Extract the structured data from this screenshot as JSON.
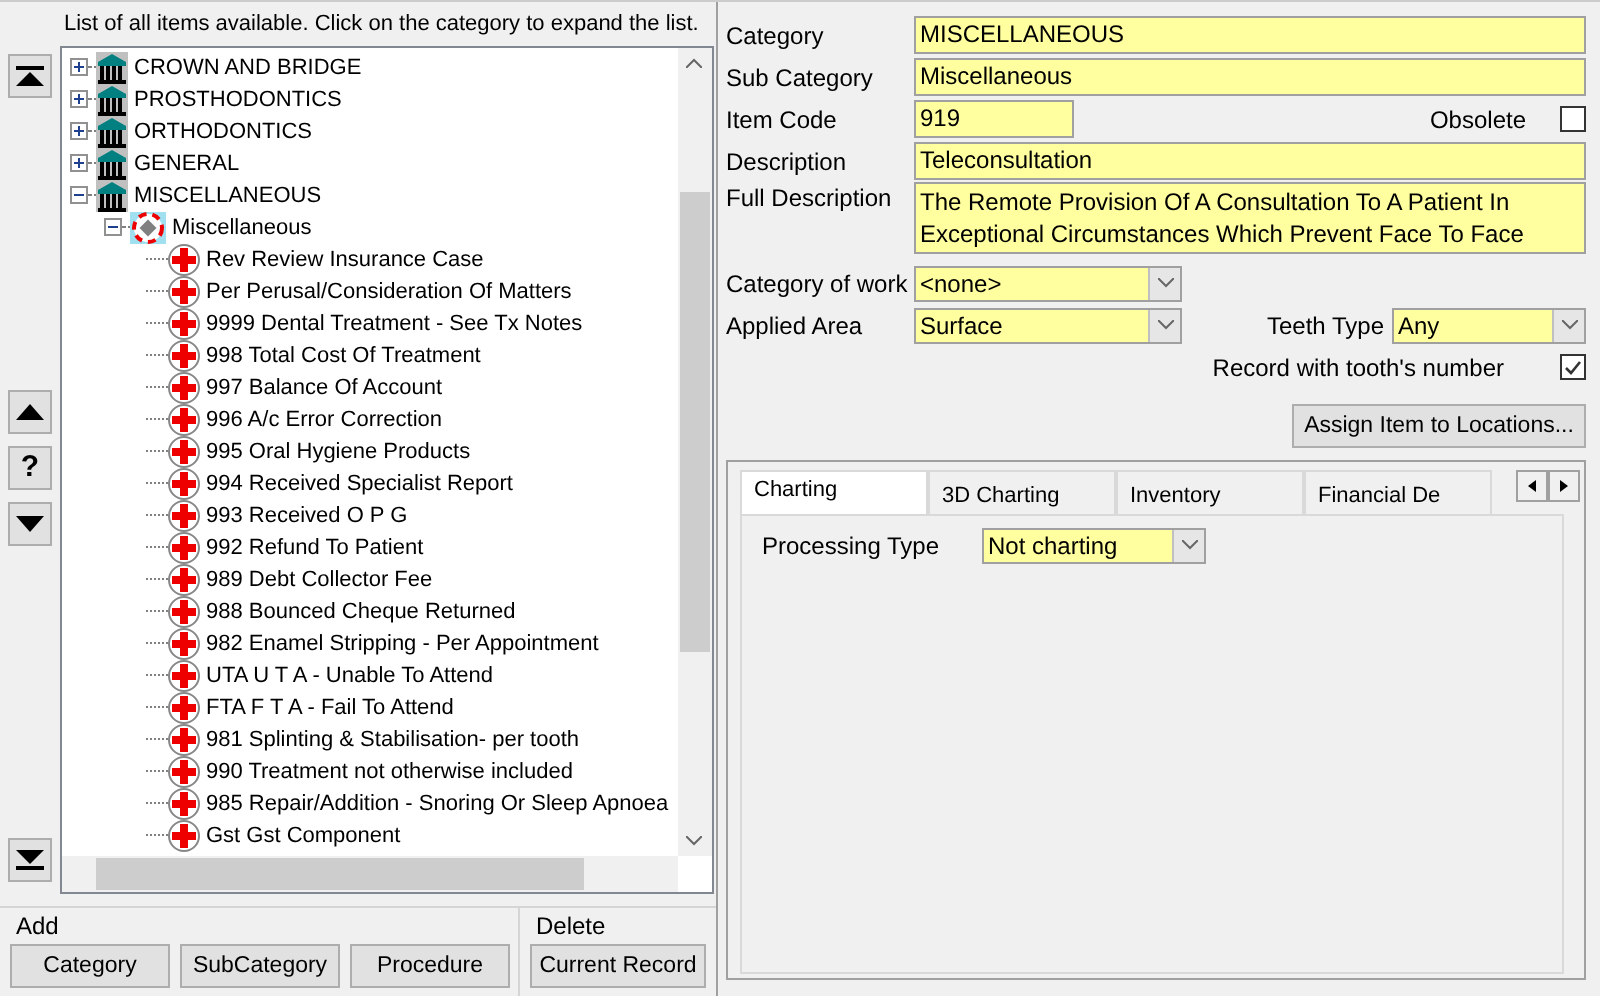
{
  "header": "List of all items available. Click on the category to expand the list.",
  "nav": {
    "help": "?"
  },
  "tree": [
    {
      "kind": "category",
      "label": "CROWN AND BRIDGE",
      "expanded": false
    },
    {
      "kind": "category",
      "label": "PROSTHODONTICS",
      "expanded": false
    },
    {
      "kind": "category",
      "label": "ORTHODONTICS",
      "expanded": false
    },
    {
      "kind": "category",
      "label": "GENERAL",
      "expanded": false
    },
    {
      "kind": "category",
      "label": "MISCELLANEOUS",
      "expanded": true,
      "children": [
        {
          "kind": "subcategory",
          "label": "Miscellaneous",
          "expanded": true,
          "children": [
            {
              "kind": "procedure",
              "label": "Rev Review Insurance Case"
            },
            {
              "kind": "procedure",
              "label": "Per Perusal/Consideration Of Matters"
            },
            {
              "kind": "procedure",
              "label": "9999 Dental Treatment - See Tx Notes"
            },
            {
              "kind": "procedure",
              "label": "998 Total Cost Of Treatment"
            },
            {
              "kind": "procedure",
              "label": "997 Balance Of Account"
            },
            {
              "kind": "procedure",
              "label": "996 A/c Error Correction"
            },
            {
              "kind": "procedure",
              "label": "995 Oral Hygiene Products"
            },
            {
              "kind": "procedure",
              "label": "994 Received Specialist Report"
            },
            {
              "kind": "procedure",
              "label": "993 Received O P G"
            },
            {
              "kind": "procedure",
              "label": "992 Refund To Patient"
            },
            {
              "kind": "procedure",
              "label": "989 Debt Collector Fee"
            },
            {
              "kind": "procedure",
              "label": "988 Bounced Cheque Returned"
            },
            {
              "kind": "procedure",
              "label": "982 Enamel Stripping - Per Appointment"
            },
            {
              "kind": "procedure",
              "label": "UTA U T A - Unable To Attend"
            },
            {
              "kind": "procedure",
              "label": "FTA F T A - Fail To Attend"
            },
            {
              "kind": "procedure",
              "label": "981 Splinting & Stabilisation- per tooth"
            },
            {
              "kind": "procedure",
              "label": "990 Treatment not otherwise included"
            },
            {
              "kind": "procedure",
              "label": "985 Repair/Addition - Snoring Or Sleep Apnoea"
            },
            {
              "kind": "procedure",
              "label": "Gst Gst Component"
            }
          ]
        }
      ]
    }
  ],
  "add": {
    "label": "Add",
    "buttons": [
      "Category",
      "SubCategory",
      "Procedure"
    ]
  },
  "delete": {
    "label": "Delete",
    "button": "Current Record"
  },
  "form": {
    "category": {
      "label": "Category",
      "value": "MISCELLANEOUS"
    },
    "sub_category": {
      "label": "Sub Category",
      "value": "Miscellaneous"
    },
    "item_code": {
      "label": "Item Code",
      "value": "919"
    },
    "obsolete": {
      "label": "Obsolete",
      "checked": false
    },
    "description": {
      "label": "Description",
      "value": "Teleconsultation"
    },
    "full_description": {
      "label": "Full Description",
      "value": "The Remote Provision Of A Consultation To A Patient In Exceptional Circumstances Which Prevent Face To Face"
    },
    "category_of_work": {
      "label": "Category of work",
      "value": "<none>"
    },
    "applied_area": {
      "label": "Applied Area",
      "value": "Surface"
    },
    "teeth_type": {
      "label": "Teeth Type",
      "value": "Any"
    },
    "record_with_tooth": {
      "label": "Record with tooth's number",
      "checked": true
    },
    "assign_button": "Assign Item to Locations..."
  },
  "tabs": [
    {
      "label": "Charting",
      "selected": true
    },
    {
      "label": "3D Charting",
      "selected": false
    },
    {
      "label": "Inventory",
      "selected": false
    },
    {
      "label": "Financial De",
      "selected": false
    }
  ],
  "charting": {
    "label": "Processing Type",
    "value": "Not charting"
  }
}
